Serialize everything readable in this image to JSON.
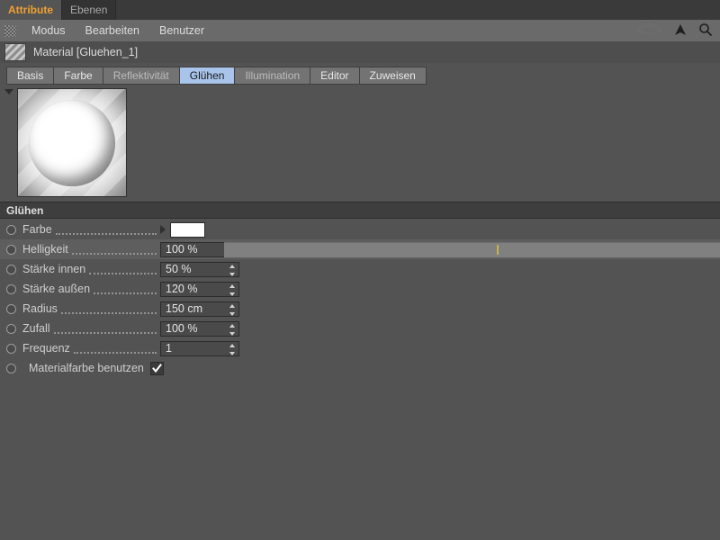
{
  "window": {
    "tabs": [
      {
        "label": "Attribute",
        "active": true
      },
      {
        "label": "Ebenen",
        "active": false
      }
    ],
    "accent_color": "#f0a030"
  },
  "menubar": {
    "grip_icon": "grip-dots-icon",
    "items": [
      "Modus",
      "Bearbeiten",
      "Benutzer"
    ],
    "right_icons": [
      "layers-plane-icon",
      "arrow-up-icon",
      "search-icon"
    ]
  },
  "material": {
    "icon": "material-swatch-icon",
    "title": "Material [Gluehen_1]"
  },
  "channel_tabs": [
    {
      "label": "Basis",
      "active": false
    },
    {
      "label": "Farbe",
      "active": false
    },
    {
      "label": "Reflektivität",
      "active": false
    },
    {
      "label": "Glühen",
      "active": true
    },
    {
      "label": "Illumination",
      "active": false
    },
    {
      "label": "Editor",
      "active": false
    },
    {
      "label": "Zuweisen",
      "active": false
    }
  ],
  "preview": {
    "expander_icon": "triangle-down-icon",
    "description": "glowing-white-sphere-on-striped-background"
  },
  "section": {
    "title": "Glühen"
  },
  "parameters": [
    {
      "name": "farbe",
      "label": "Farbe",
      "type": "color",
      "value": "#ffffff",
      "expander_icon": "triangle-right-icon"
    },
    {
      "name": "helligkeit",
      "label": "Helligkeit",
      "type": "number",
      "value": "100 %",
      "highlighted": true,
      "slider": {
        "marker_percent": 55,
        "marker_color": "#c7b34a"
      }
    },
    {
      "name": "staerke-innen",
      "label": "Stärke innen",
      "type": "number",
      "value": "50 %"
    },
    {
      "name": "staerke-aussen",
      "label": "Stärke außen",
      "type": "number",
      "value": "120 %"
    },
    {
      "name": "radius",
      "label": "Radius",
      "type": "number",
      "value": "150 cm"
    },
    {
      "name": "zufall",
      "label": "Zufall",
      "type": "number",
      "value": "100 %"
    },
    {
      "name": "frequenz",
      "label": "Frequenz",
      "type": "number",
      "value": "1"
    },
    {
      "name": "materialfarbe-benutzen",
      "label": "Materialfarbe benutzen",
      "type": "checkbox",
      "checked": true
    }
  ]
}
